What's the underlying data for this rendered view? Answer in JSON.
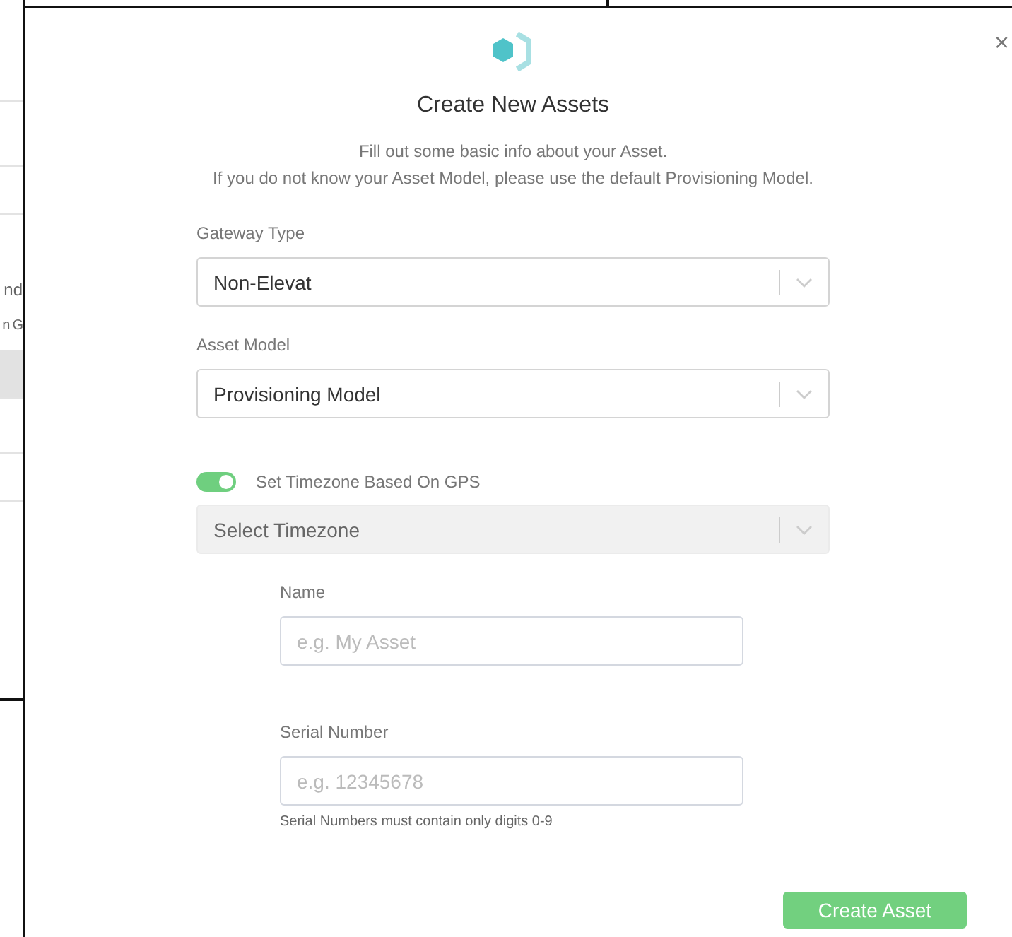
{
  "background_list": {
    "rows": [
      {
        "selected": false
      },
      {
        "selected": false
      },
      {
        "selected": false
      },
      {
        "text": "nd",
        "selected": false
      },
      {
        "text": "n G",
        "selected": false
      },
      {
        "selected": true
      },
      {
        "selected": false
      },
      {
        "selected": false
      }
    ]
  },
  "dialog": {
    "close": "×",
    "title": "Create New Assets",
    "intro": [
      "Fill out some basic info about your Asset.",
      "If you do not know your Asset Model, please use the default Provisioning Model."
    ],
    "gateway_type": {
      "label": "Gateway Type",
      "value": "Non-Elevat",
      "disabled": false
    },
    "asset_model": {
      "label": "Asset Model",
      "value": "Provisioning Model",
      "disabled": false
    },
    "timezone_toggle": {
      "label": "Set Timezone Based On GPS",
      "on": true
    },
    "timezone": {
      "placeholder": "Select Timezone",
      "disabled": true
    },
    "name": {
      "label": "Name",
      "placeholder": "e.g. My Asset"
    },
    "serial_number": {
      "label": "Serial Number",
      "placeholder": "e.g. 12345678",
      "hint": "Serial Numbers must contain only digits 0-9"
    },
    "submit": "Create Asset"
  }
}
